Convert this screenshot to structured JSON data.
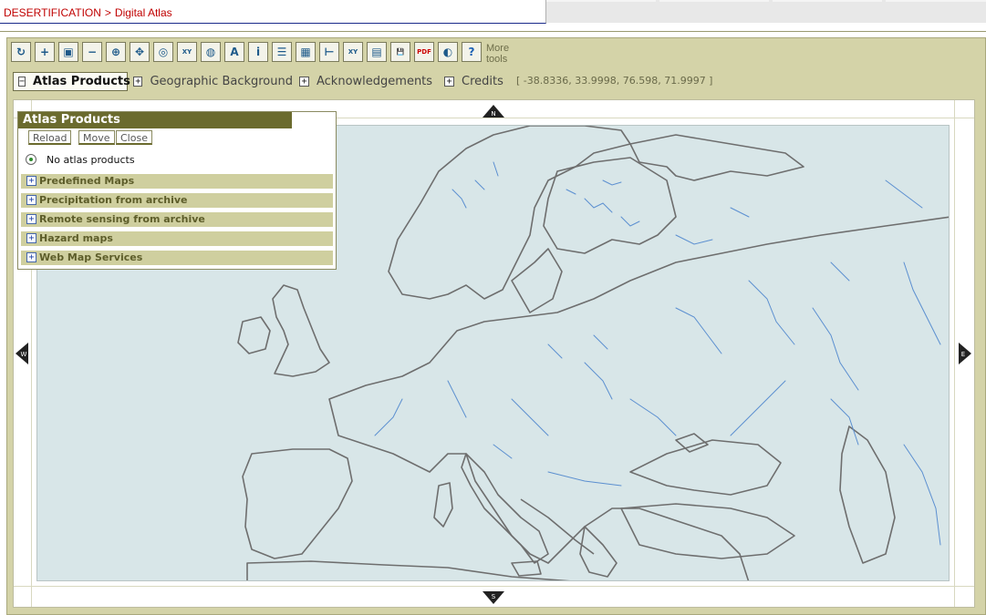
{
  "breadcrumb": {
    "root": "DESERTIFICATION",
    "separator": ">",
    "current": "Digital Atlas"
  },
  "toolbar": {
    "tools": [
      {
        "name": "refresh-icon",
        "glyph": "↻"
      },
      {
        "name": "zoom-in-icon",
        "glyph": "+"
      },
      {
        "name": "zoom-box-icon",
        "glyph": "▣"
      },
      {
        "name": "zoom-out-icon",
        "glyph": "−"
      },
      {
        "name": "zoom-full-icon",
        "glyph": "⊕"
      },
      {
        "name": "pan-icon",
        "glyph": "✥"
      },
      {
        "name": "zoom-extent-icon",
        "glyph": "◎"
      },
      {
        "name": "zoom-xy-icon",
        "glyph": "XY"
      },
      {
        "name": "zoom-previous-icon",
        "glyph": "◍"
      },
      {
        "name": "zoom-next-icon",
        "glyph": "A"
      },
      {
        "name": "info-icon",
        "glyph": "i"
      },
      {
        "name": "legend-icon",
        "glyph": "☰"
      },
      {
        "name": "chart-icon",
        "glyph": "▦"
      },
      {
        "name": "measure-icon",
        "glyph": "⊢"
      },
      {
        "name": "coordinates-icon",
        "glyph": "XY"
      },
      {
        "name": "image-export-icon",
        "glyph": "▤"
      },
      {
        "name": "save-icon",
        "glyph": "💾"
      },
      {
        "name": "pdf-icon",
        "glyph": "PDF"
      },
      {
        "name": "globe-icon",
        "glyph": "◐"
      },
      {
        "name": "help-icon",
        "glyph": "?"
      }
    ],
    "more_label_line1": "More",
    "more_label_line2": "tools"
  },
  "tabs": [
    {
      "label": "Atlas Products",
      "state": "−",
      "active": true
    },
    {
      "label": "Geographic Background",
      "state": "+",
      "active": false
    },
    {
      "label": "Acknowledgements",
      "state": "+",
      "active": false
    },
    {
      "label": "Credits",
      "state": "+",
      "active": false
    }
  ],
  "coords": "[ -38.8336, 33.9998, 76.598, 71.9997 ]",
  "panel": {
    "title": "Atlas Products",
    "buttons": [
      "Reload",
      "Move",
      "Close"
    ],
    "selection": "No atlas products",
    "categories": [
      {
        "label": "Predefined Maps",
        "state": "+"
      },
      {
        "label": "Precipitation from archive",
        "state": "+"
      },
      {
        "label": "Remote sensing from archive",
        "state": "+"
      },
      {
        "label": "Hazard maps",
        "state": "+"
      },
      {
        "label": "Web Map Services",
        "state": "+"
      }
    ]
  },
  "pan_arrows": {
    "north": "N",
    "south": "S",
    "west": "W",
    "east": "E"
  },
  "colors": {
    "frame": "#d4d3a8",
    "panel_title": "#6b6b2e",
    "sea": "#d8e6e8",
    "coast": "#6e6e6e",
    "rivers": "#5b8fd0",
    "breadcrumb": "#c00000"
  }
}
